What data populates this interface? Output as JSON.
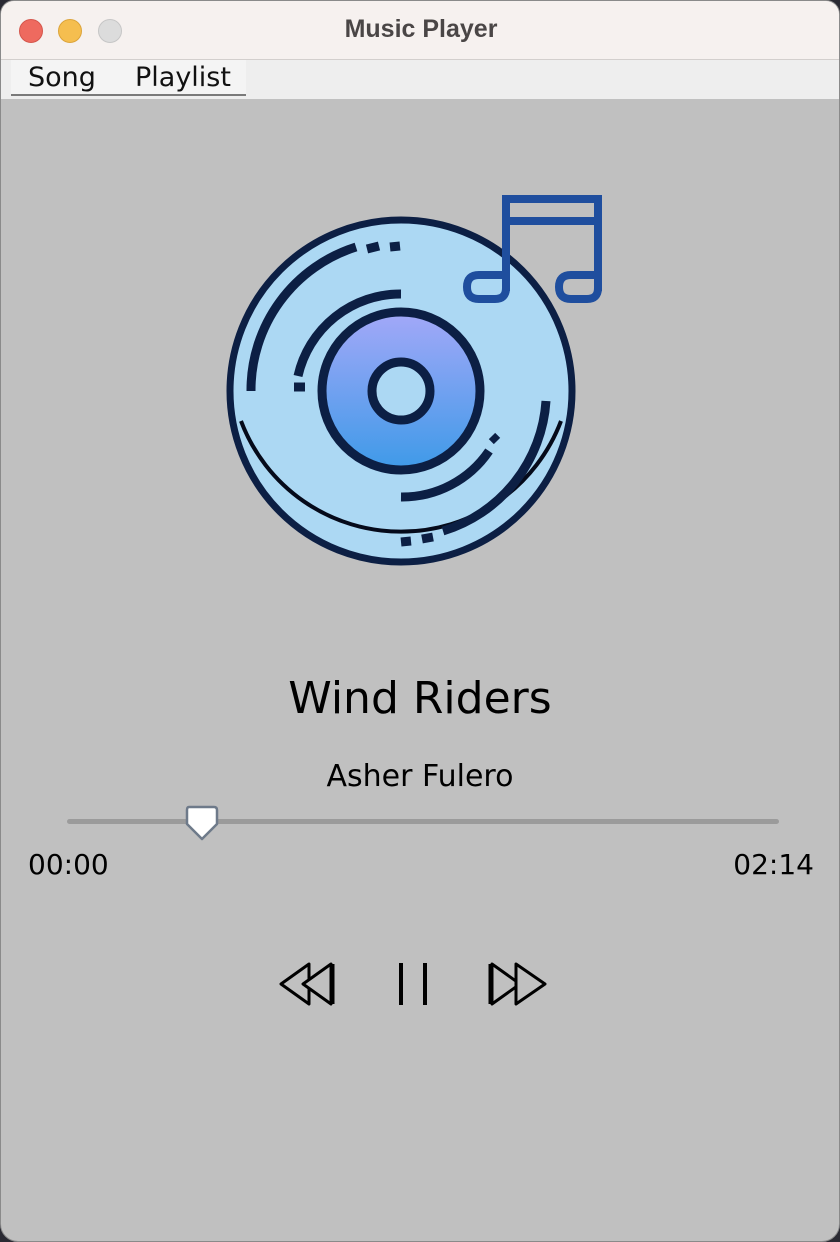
{
  "window": {
    "title": "Music Player",
    "controls": [
      "close",
      "minimize",
      "zoom"
    ]
  },
  "menu": {
    "items": [
      {
        "label": "Song"
      },
      {
        "label": "Playlist"
      }
    ]
  },
  "album_art": {
    "icon": "vinyl-record-with-music-note-icon",
    "colors": {
      "disc": "#acd8f3",
      "center_top": "#a3a8f8",
      "center_bottom": "#3e9ae8",
      "note": "#1f4e9e",
      "outline": "#0c1f44"
    }
  },
  "song": {
    "title": "Wind Riders",
    "artist": "Asher Fulero"
  },
  "playback": {
    "current_time": "00:00",
    "total_time": "02:14",
    "progress_fraction": 0.19
  },
  "controls": {
    "prev_icon": "rewind-icon",
    "pause_icon": "pause-icon",
    "next_icon": "fast-forward-icon"
  },
  "colors": {
    "window_background": "#c0c0c0",
    "titlebar": "#f6f1ef",
    "close": "#ee6a5f",
    "minimize": "#f5be4f",
    "zoom": "#dcdcdc"
  }
}
